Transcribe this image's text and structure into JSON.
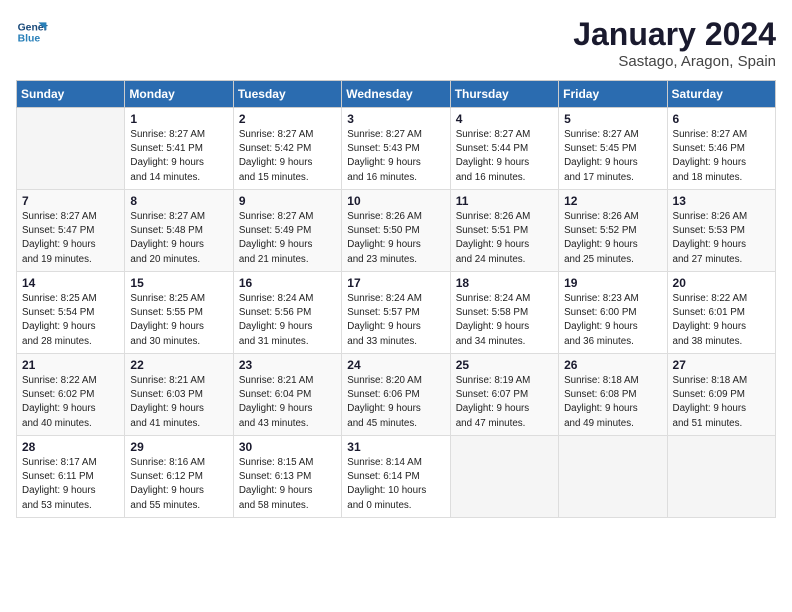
{
  "logo": {
    "line1": "General",
    "line2": "Blue"
  },
  "title": "January 2024",
  "subtitle": "Sastago, Aragon, Spain",
  "weekdays": [
    "Sunday",
    "Monday",
    "Tuesday",
    "Wednesday",
    "Thursday",
    "Friday",
    "Saturday"
  ],
  "weeks": [
    [
      {
        "day": "",
        "info": ""
      },
      {
        "day": "1",
        "info": "Sunrise: 8:27 AM\nSunset: 5:41 PM\nDaylight: 9 hours\nand 14 minutes."
      },
      {
        "day": "2",
        "info": "Sunrise: 8:27 AM\nSunset: 5:42 PM\nDaylight: 9 hours\nand 15 minutes."
      },
      {
        "day": "3",
        "info": "Sunrise: 8:27 AM\nSunset: 5:43 PM\nDaylight: 9 hours\nand 16 minutes."
      },
      {
        "day": "4",
        "info": "Sunrise: 8:27 AM\nSunset: 5:44 PM\nDaylight: 9 hours\nand 16 minutes."
      },
      {
        "day": "5",
        "info": "Sunrise: 8:27 AM\nSunset: 5:45 PM\nDaylight: 9 hours\nand 17 minutes."
      },
      {
        "day": "6",
        "info": "Sunrise: 8:27 AM\nSunset: 5:46 PM\nDaylight: 9 hours\nand 18 minutes."
      }
    ],
    [
      {
        "day": "7",
        "info": "Sunrise: 8:27 AM\nSunset: 5:47 PM\nDaylight: 9 hours\nand 19 minutes."
      },
      {
        "day": "8",
        "info": "Sunrise: 8:27 AM\nSunset: 5:48 PM\nDaylight: 9 hours\nand 20 minutes."
      },
      {
        "day": "9",
        "info": "Sunrise: 8:27 AM\nSunset: 5:49 PM\nDaylight: 9 hours\nand 21 minutes."
      },
      {
        "day": "10",
        "info": "Sunrise: 8:26 AM\nSunset: 5:50 PM\nDaylight: 9 hours\nand 23 minutes."
      },
      {
        "day": "11",
        "info": "Sunrise: 8:26 AM\nSunset: 5:51 PM\nDaylight: 9 hours\nand 24 minutes."
      },
      {
        "day": "12",
        "info": "Sunrise: 8:26 AM\nSunset: 5:52 PM\nDaylight: 9 hours\nand 25 minutes."
      },
      {
        "day": "13",
        "info": "Sunrise: 8:26 AM\nSunset: 5:53 PM\nDaylight: 9 hours\nand 27 minutes."
      }
    ],
    [
      {
        "day": "14",
        "info": "Sunrise: 8:25 AM\nSunset: 5:54 PM\nDaylight: 9 hours\nand 28 minutes."
      },
      {
        "day": "15",
        "info": "Sunrise: 8:25 AM\nSunset: 5:55 PM\nDaylight: 9 hours\nand 30 minutes."
      },
      {
        "day": "16",
        "info": "Sunrise: 8:24 AM\nSunset: 5:56 PM\nDaylight: 9 hours\nand 31 minutes."
      },
      {
        "day": "17",
        "info": "Sunrise: 8:24 AM\nSunset: 5:57 PM\nDaylight: 9 hours\nand 33 minutes."
      },
      {
        "day": "18",
        "info": "Sunrise: 8:24 AM\nSunset: 5:58 PM\nDaylight: 9 hours\nand 34 minutes."
      },
      {
        "day": "19",
        "info": "Sunrise: 8:23 AM\nSunset: 6:00 PM\nDaylight: 9 hours\nand 36 minutes."
      },
      {
        "day": "20",
        "info": "Sunrise: 8:22 AM\nSunset: 6:01 PM\nDaylight: 9 hours\nand 38 minutes."
      }
    ],
    [
      {
        "day": "21",
        "info": "Sunrise: 8:22 AM\nSunset: 6:02 PM\nDaylight: 9 hours\nand 40 minutes."
      },
      {
        "day": "22",
        "info": "Sunrise: 8:21 AM\nSunset: 6:03 PM\nDaylight: 9 hours\nand 41 minutes."
      },
      {
        "day": "23",
        "info": "Sunrise: 8:21 AM\nSunset: 6:04 PM\nDaylight: 9 hours\nand 43 minutes."
      },
      {
        "day": "24",
        "info": "Sunrise: 8:20 AM\nSunset: 6:06 PM\nDaylight: 9 hours\nand 45 minutes."
      },
      {
        "day": "25",
        "info": "Sunrise: 8:19 AM\nSunset: 6:07 PM\nDaylight: 9 hours\nand 47 minutes."
      },
      {
        "day": "26",
        "info": "Sunrise: 8:18 AM\nSunset: 6:08 PM\nDaylight: 9 hours\nand 49 minutes."
      },
      {
        "day": "27",
        "info": "Sunrise: 8:18 AM\nSunset: 6:09 PM\nDaylight: 9 hours\nand 51 minutes."
      }
    ],
    [
      {
        "day": "28",
        "info": "Sunrise: 8:17 AM\nSunset: 6:11 PM\nDaylight: 9 hours\nand 53 minutes."
      },
      {
        "day": "29",
        "info": "Sunrise: 8:16 AM\nSunset: 6:12 PM\nDaylight: 9 hours\nand 55 minutes."
      },
      {
        "day": "30",
        "info": "Sunrise: 8:15 AM\nSunset: 6:13 PM\nDaylight: 9 hours\nand 58 minutes."
      },
      {
        "day": "31",
        "info": "Sunrise: 8:14 AM\nSunset: 6:14 PM\nDaylight: 10 hours\nand 0 minutes."
      },
      {
        "day": "",
        "info": ""
      },
      {
        "day": "",
        "info": ""
      },
      {
        "day": "",
        "info": ""
      }
    ]
  ]
}
